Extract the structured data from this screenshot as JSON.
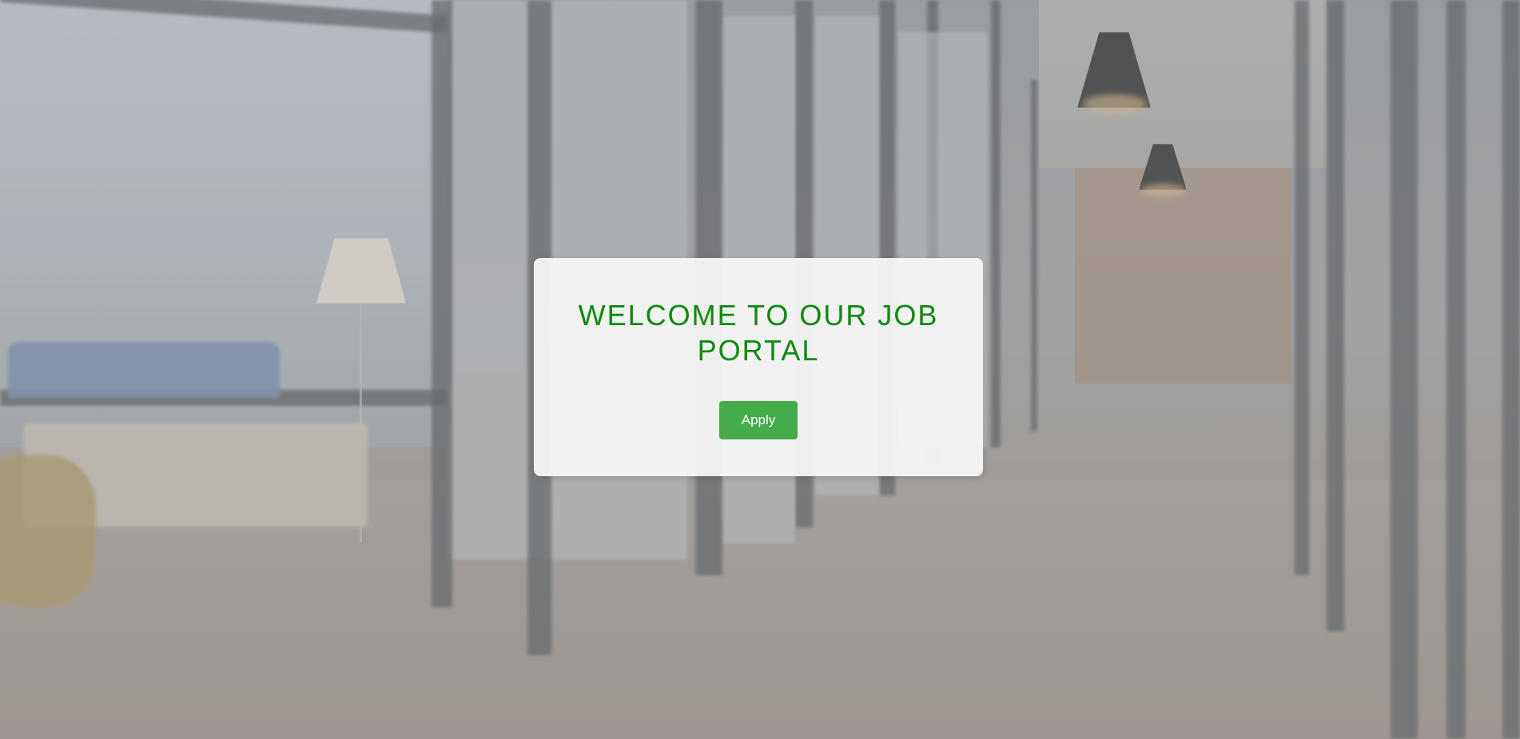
{
  "welcome_card": {
    "title": "WELCOME TO OUR JOB PORTAL",
    "apply_label": "Apply"
  },
  "colors": {
    "title_text": "#0d8a0d",
    "button_background": "#45ab4b",
    "button_text": "#ffffff",
    "card_background": "#f5f5f5"
  },
  "background": {
    "icon": "blurred-office-corridor-photo"
  }
}
